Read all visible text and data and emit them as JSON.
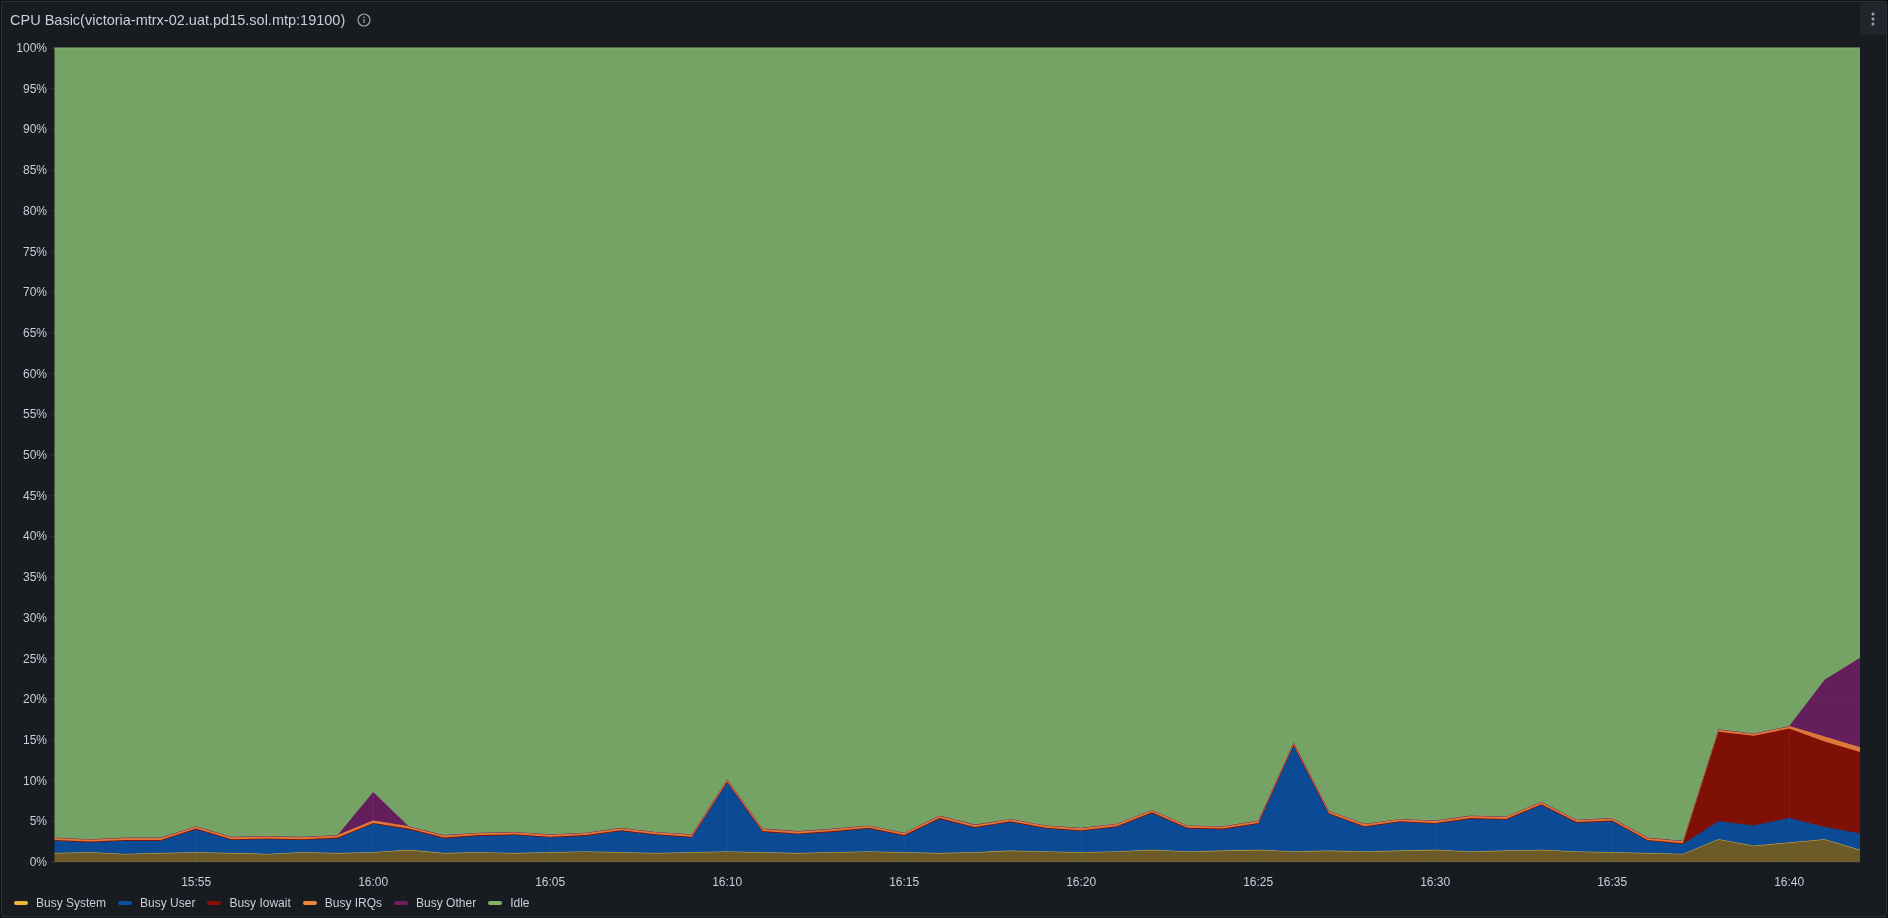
{
  "panel": {
    "title": "CPU Basic(victoria-mtrx-02.uat.pd15.sol.mtp:19100)",
    "chart_data": {
      "type": "area",
      "stacked": true,
      "categories": [
        null,
        null,
        null,
        null,
        "15:55",
        null,
        null,
        null,
        null,
        "16:00",
        null,
        null,
        null,
        null,
        "16:05",
        null,
        null,
        null,
        null,
        "16:10",
        null,
        null,
        null,
        null,
        "16:15",
        null,
        null,
        null,
        null,
        "16:20",
        null,
        null,
        null,
        null,
        "16:25",
        null,
        null,
        null,
        null,
        "16:30",
        null,
        null,
        null,
        null,
        "16:35",
        null,
        null,
        null,
        null,
        "16:40",
        null,
        null
      ],
      "series": [
        {
          "name": "Busy System",
          "color": "#eab839",
          "values": [
            1.1,
            1.2,
            1.0,
            1.1,
            1.2,
            1.1,
            1.0,
            1.2,
            1.1,
            1.2,
            1.5,
            1.1,
            1.2,
            1.1,
            1.2,
            1.3,
            1.2,
            1.1,
            1.2,
            1.3,
            1.2,
            1.1,
            1.2,
            1.3,
            1.2,
            1.1,
            1.2,
            1.4,
            1.3,
            1.2,
            1.3,
            1.5,
            1.3,
            1.4,
            1.5,
            1.3,
            1.4,
            1.3,
            1.4,
            1.5,
            1.3,
            1.4,
            1.5,
            1.3,
            1.2,
            1.1,
            1.0,
            2.8,
            2.0,
            2.4,
            2.8,
            1.5
          ]
        },
        {
          "name": "Busy User",
          "color": "#0a50a1",
          "values": [
            1.5,
            1.2,
            1.6,
            1.5,
            2.8,
            1.6,
            1.8,
            1.5,
            1.8,
            3.5,
            2.5,
            1.8,
            2.0,
            2.2,
            1.8,
            1.9,
            2.6,
            2.2,
            1.8,
            8.5,
            2.5,
            2.3,
            2.5,
            2.8,
            2.0,
            4.2,
            3.0,
            3.5,
            2.8,
            2.6,
            3.0,
            4.5,
            2.8,
            2.6,
            3.2,
            13.0,
            4.5,
            3.0,
            3.5,
            3.2,
            4.0,
            3.8,
            5.5,
            3.5,
            3.8,
            1.5,
            1.2,
            2.2,
            2.5,
            3.0,
            1.5,
            2.0
          ]
        },
        {
          "name": "Busy Iowait",
          "color": "#890f02",
          "values": [
            0.1,
            0.1,
            0.1,
            0.1,
            0.1,
            0.1,
            0.1,
            0.1,
            0.1,
            0.1,
            0.1,
            0.1,
            0.1,
            0.1,
            0.1,
            0.1,
            0.1,
            0.1,
            0.1,
            0.1,
            0.1,
            0.1,
            0.1,
            0.1,
            0.1,
            0.1,
            0.1,
            0.1,
            0.1,
            0.1,
            0.1,
            0.1,
            0.1,
            0.1,
            0.1,
            0.1,
            0.1,
            0.1,
            0.1,
            0.1,
            0.1,
            0.1,
            0.1,
            0.1,
            0.1,
            0.1,
            0.1,
            11,
            11,
            11,
            10.5,
            10
          ]
        },
        {
          "name": "Busy IRQs",
          "color": "#ef843c",
          "values": [
            0.3,
            0.3,
            0.3,
            0.3,
            0.3,
            0.3,
            0.3,
            0.3,
            0.3,
            0.3,
            0.3,
            0.3,
            0.3,
            0.3,
            0.3,
            0.3,
            0.3,
            0.3,
            0.3,
            0.3,
            0.3,
            0.3,
            0.3,
            0.3,
            0.3,
            0.3,
            0.3,
            0.3,
            0.3,
            0.3,
            0.3,
            0.3,
            0.3,
            0.3,
            0.3,
            0.3,
            0.3,
            0.3,
            0.3,
            0.3,
            0.3,
            0.3,
            0.3,
            0.3,
            0.3,
            0.3,
            0.3,
            0.3,
            0.3,
            0.3,
            0.6,
            0.6
          ]
        },
        {
          "name": "Busy Other",
          "color": "#6d1f62",
          "values": [
            0,
            0,
            0,
            0,
            0,
            0,
            0,
            0,
            0,
            3.5,
            0,
            0,
            0,
            0,
            0,
            0,
            0,
            0,
            0,
            0,
            0,
            0,
            0,
            0,
            0,
            0,
            0,
            0,
            0,
            0,
            0,
            0,
            0,
            0,
            0,
            0,
            0,
            0,
            0,
            0,
            0,
            0,
            0,
            0,
            0,
            0,
            0,
            0,
            0,
            0,
            7,
            11
          ]
        },
        {
          "name": "Idle",
          "color": "#7eb26d",
          "values": [
            97.0,
            97.2,
            97.0,
            97.0,
            95.6,
            96.9,
            96.8,
            96.9,
            96.7,
            91.4,
            95.6,
            96.7,
            96.4,
            96.3,
            96.6,
            96.4,
            95.8,
            96.3,
            96.6,
            89.8,
            95.9,
            96.2,
            95.9,
            95.5,
            96.4,
            94.3,
            95.4,
            94.7,
            95.5,
            95.8,
            95.3,
            93.6,
            95.5,
            95.6,
            94.9,
            85.3,
            93.7,
            95.3,
            94.7,
            94.9,
            94.3,
            94.4,
            92.6,
            94.8,
            94.6,
            97.0,
            97.4,
            83.7,
            84.2,
            83.3,
            77.6,
            74.9
          ]
        }
      ],
      "ylim": [
        0,
        100
      ],
      "grid": true,
      "yticks": [
        {
          "value": 0,
          "label": "0%"
        },
        {
          "value": 5,
          "label": "5%"
        },
        {
          "value": 10,
          "label": "10%"
        },
        {
          "value": 15,
          "label": "15%"
        },
        {
          "value": 20,
          "label": "20%"
        },
        {
          "value": 25,
          "label": "25%"
        },
        {
          "value": 30,
          "label": "30%"
        },
        {
          "value": 35,
          "label": "35%"
        },
        {
          "value": 40,
          "label": "40%"
        },
        {
          "value": 45,
          "label": "45%"
        },
        {
          "value": 50,
          "label": "50%"
        },
        {
          "value": 55,
          "label": "55%"
        },
        {
          "value": 60,
          "label": "60%"
        },
        {
          "value": 65,
          "label": "65%"
        },
        {
          "value": 70,
          "label": "70%"
        },
        {
          "value": 75,
          "label": "75%"
        },
        {
          "value": 80,
          "label": "80%"
        },
        {
          "value": 85,
          "label": "85%"
        },
        {
          "value": 90,
          "label": "90%"
        },
        {
          "value": 95,
          "label": "95%"
        },
        {
          "value": 100,
          "label": "100%"
        }
      ]
    }
  }
}
